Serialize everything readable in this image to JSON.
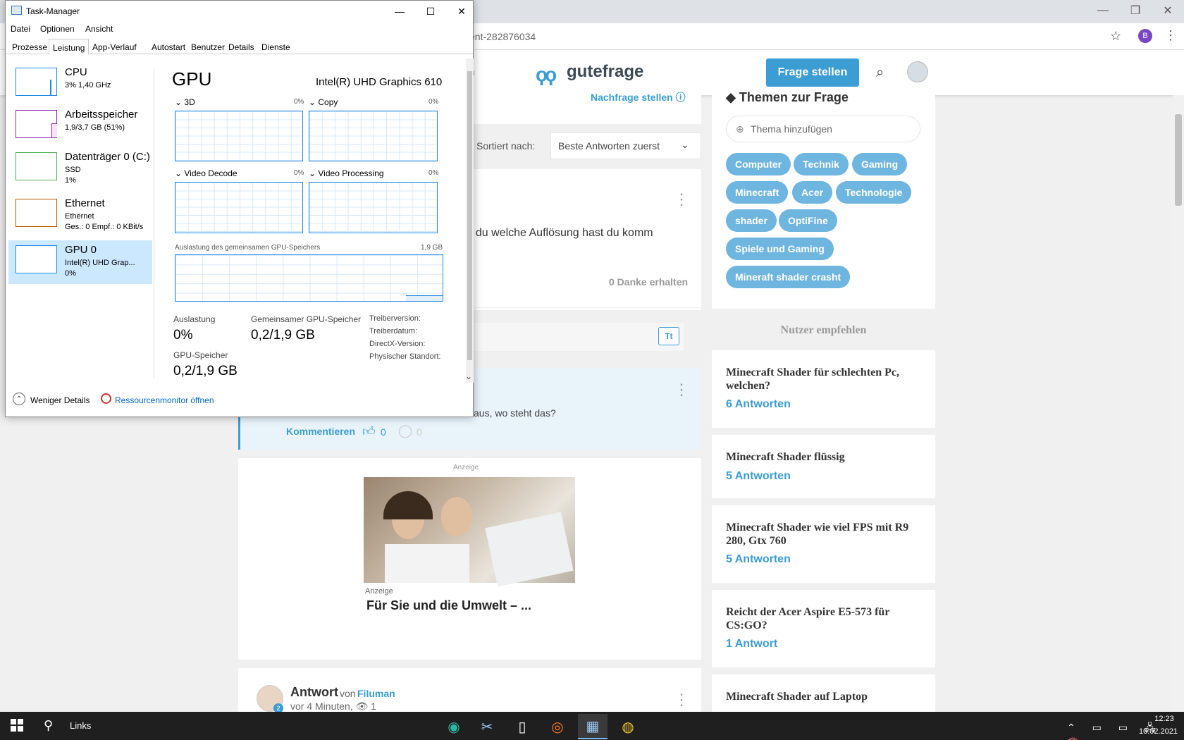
{
  "browser": {
    "url_fragment": "ent-282876034",
    "profile_initial": "B",
    "icons": {
      "star": "star-icon",
      "menu": "kebab-menu-icon",
      "minimize": "minimize-icon",
      "maximize": "restore-icon",
      "close": "close-icon"
    }
  },
  "site": {
    "logo_mark": "ϙϙ",
    "logo_text": "gutefrage",
    "ask_button": "Frage stellen",
    "header_fragment": "n",
    "nachfrage": "Nachfrage stellen ⓘ",
    "sort_label": "Sortiert nach:",
    "sort_value": "Beste Antworten zuerst",
    "answer1_text": "t du welche Auflösung hast du komm",
    "answer1_thanks": "0 Danke erhalten",
    "comment_tt": "Tt",
    "comment_text": "aus, wo steht das?",
    "kommentieren": "Kommentieren",
    "like_count": "0",
    "reply_count": "0",
    "ad_label": "Anzeige",
    "ad_label_small": "Anzeige",
    "ad_title": "Für Sie und die Umwelt – ...",
    "answer2_title": "Antwort",
    "answer2_von": "von",
    "answer2_user": "Filuman",
    "answer2_meta": "vor 4 Minuten, 👁 1",
    "avatar_badge": "2"
  },
  "themen": {
    "title": "Themen zur Frage",
    "input_placeholder": "Thema hinzufügen",
    "tags": [
      "Computer",
      "Technik",
      "Gaming",
      "Minecraft",
      "Acer",
      "Technologie",
      "shader",
      "OptiFine",
      "Spiele und Gaming",
      "Mineraft shader crasht"
    ]
  },
  "nutzer_empfehlen": "Nutzer empfehlen",
  "related": [
    {
      "title": "Minecraft Shader für schlechten Pc, welchen?",
      "count": "6 Antworten"
    },
    {
      "title": "Minecraft Shader flüssig",
      "count": "5 Antworten"
    },
    {
      "title": "Minecraft Shader wie viel FPS mit R9 280, Gtx 760",
      "count": "5 Antworten"
    },
    {
      "title": "Reicht der Acer Aspire E5-573 für CS:GO?",
      "count": "1 Antwort"
    },
    {
      "title": "Minecraft Shader auf Laptop",
      "count": ""
    }
  ],
  "taskmanager": {
    "title": "Task-Manager",
    "menu": [
      "Datei",
      "Optionen",
      "Ansicht"
    ],
    "tabs": [
      "Prozesse",
      "Leistung",
      "App-Verlauf",
      "Autostart",
      "Benutzer",
      "Details",
      "Dienste"
    ],
    "active_tab": "Leistung",
    "sidebar": [
      {
        "name": "CPU",
        "sub1": "3%  1,40 GHz",
        "sub2": "",
        "color": "#1e88e5"
      },
      {
        "name": "Arbeitsspeicher",
        "sub1": "1,9/3,7 GB (51%)",
        "sub2": "",
        "color": "#8e24aa"
      },
      {
        "name": "Datenträger 0 (C:)",
        "sub1": "SSD",
        "sub2": "1%",
        "color": "#4caf50"
      },
      {
        "name": "Ethernet",
        "sub1": "Ethernet",
        "sub2": "Ges.: 0  Empf.: 0 KBit/s",
        "color": "#b35a00"
      },
      {
        "name": "GPU 0",
        "sub1": "Intel(R) UHD Grap...",
        "sub2": "0%",
        "color": "#1e88e5"
      }
    ],
    "heading": "GPU",
    "model": "Intel(R) UHD Graphics 610",
    "engines": [
      {
        "label": "3D",
        "pct": "0%"
      },
      {
        "label": "Copy",
        "pct": "0%"
      },
      {
        "label": "Video Decode",
        "pct": "0%"
      },
      {
        "label": "Video Processing",
        "pct": "0%"
      }
    ],
    "shared_label": "Auslastung des gemeinsamen GPU-Speichers",
    "shared_max": "1,9 GB",
    "stats": {
      "auslastung_label": "Auslastung",
      "auslastung_val": "0%",
      "gemeinsam_label": "Gemeinsamer GPU-Speicher",
      "gemeinsam_val": "0,2/1,9 GB",
      "gpuspeicher_label": "GPU-Speicher",
      "gpuspeicher_val": "0,2/1,9 GB"
    },
    "driver": [
      "Treiberversion:",
      "Treiberdatum:",
      "DirectX-Version:",
      "Physischer Standort:"
    ],
    "footer_less": "Weniger Details",
    "footer_resmon": "Ressourcenmonitor öffnen"
  },
  "taskbar": {
    "search_label": "Links",
    "time": "12:23",
    "date": "10.02.2021",
    "tray": "⌃ ▭ ▭ 🖧 🔇",
    "apps": [
      "edge-icon",
      "snipping-icon",
      "file-icon",
      "firefox-icon",
      "taskmanager-icon",
      "chrome-icon"
    ]
  }
}
